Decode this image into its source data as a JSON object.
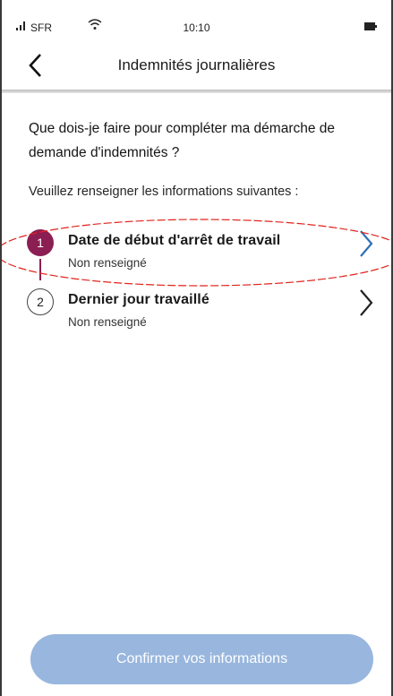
{
  "status_bar": {
    "carrier": "SFR",
    "time": "10:10",
    "signal_icon": "signal-bars-icon",
    "wifi_icon": "wifi-icon",
    "battery_icon": "battery-icon"
  },
  "nav": {
    "back_icon": "chevron-left-icon",
    "title": "Indemnités journalières"
  },
  "content": {
    "question": "Que dois-je faire pour compléter ma démarche de demande d'indemnités ?",
    "instructions": "Veuillez renseigner les informations suivantes :"
  },
  "steps": [
    {
      "number": "1",
      "title": "Date de début d'arrêt de travail",
      "status": "Non renseigné",
      "active": true
    },
    {
      "number": "2",
      "title": "Dernier jour travaillé",
      "status": "Non renseigné",
      "active": false
    }
  ],
  "confirm_button": {
    "label": "Confirmer vos informations"
  },
  "colors": {
    "accent": "#8b1e53",
    "link_blue": "#2d6fb6",
    "button_disabled": "#98b6de",
    "annotation_red": "#e0231c"
  }
}
